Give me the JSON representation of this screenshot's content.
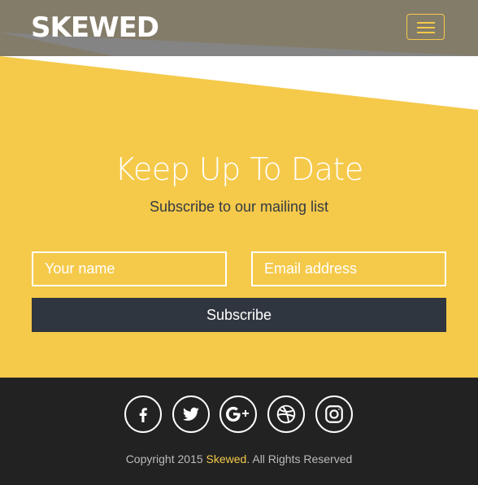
{
  "brand": {
    "name": "SKEWED"
  },
  "nav": {
    "toggle_icon": "hamburger-icon"
  },
  "subscribe_section": {
    "title": "Keep Up To Date",
    "subtitle": "Subscribe to our mailing list",
    "name_placeholder": "Your name",
    "email_placeholder": "Email address",
    "button_label": "Subscribe"
  },
  "footer": {
    "social_icons": [
      "facebook-icon",
      "twitter-icon",
      "google-plus-icon",
      "dribbble-icon",
      "instagram-icon"
    ],
    "copyright_prefix": "Copyright 2015 ",
    "copyright_brand": "Skewed",
    "copyright_suffix": ". All Rights Reserved"
  },
  "colors": {
    "accent": "#f5c94a",
    "dark": "#30363f",
    "footer": "#222222",
    "navbar": "#6e6e6e"
  }
}
